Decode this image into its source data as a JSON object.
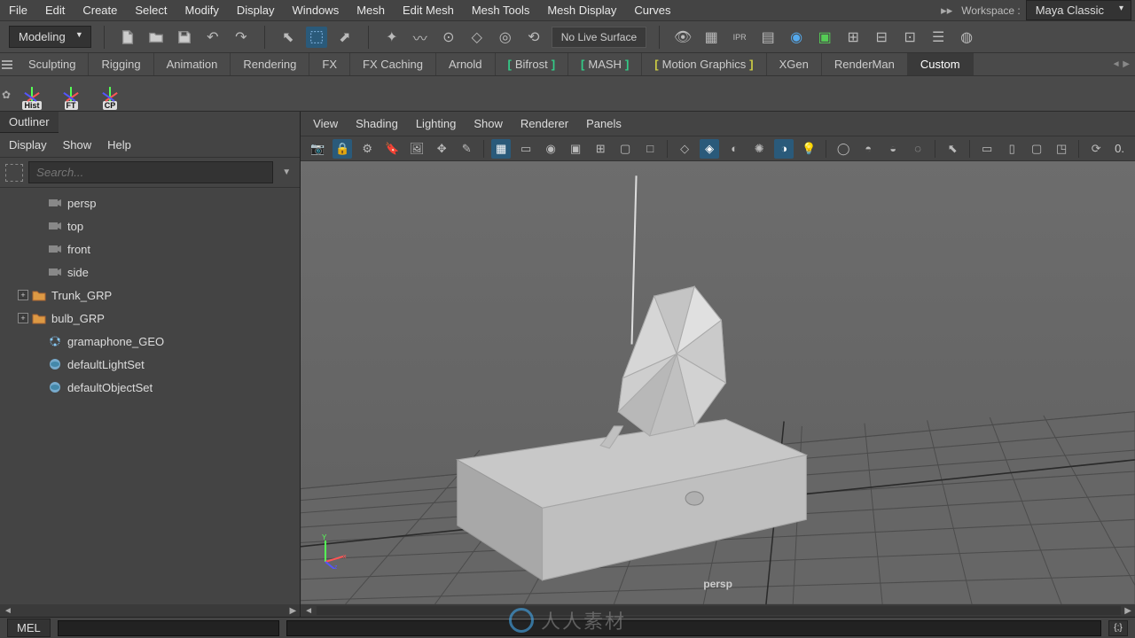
{
  "menubar": [
    "File",
    "Edit",
    "Create",
    "Select",
    "Modify",
    "Display",
    "Windows",
    "Mesh",
    "Edit Mesh",
    "Mesh Tools",
    "Mesh Display",
    "Curves"
  ],
  "workspace_label": "Workspace :",
  "workspace_value": "Maya Classic",
  "module_dropdown": "Modeling",
  "no_live_surface": "No Live Surface",
  "shelf_tabs": [
    {
      "label": "Sculpting",
      "cls": ""
    },
    {
      "label": "Rigging",
      "cls": ""
    },
    {
      "label": "Animation",
      "cls": ""
    },
    {
      "label": "Rendering",
      "cls": ""
    },
    {
      "label": "FX",
      "cls": ""
    },
    {
      "label": "FX Caching",
      "cls": ""
    },
    {
      "label": "Arnold",
      "cls": ""
    },
    {
      "label": "Bifrost",
      "cls": "bracket-l bracket-r"
    },
    {
      "label": "MASH",
      "cls": "bracket-l bracket-r"
    },
    {
      "label": "Motion Graphics",
      "cls": "bracket-y"
    },
    {
      "label": "XGen",
      "cls": ""
    },
    {
      "label": "RenderMan",
      "cls": ""
    },
    {
      "label": "Custom",
      "cls": "active"
    }
  ],
  "shelf_buttons": [
    {
      "label": "Hist",
      "color": "#e6c"
    },
    {
      "label": "FT",
      "color": "#5c5"
    },
    {
      "label": "CP",
      "color": "#c55"
    }
  ],
  "outliner": {
    "title": "Outliner",
    "menus": [
      "Display",
      "Show",
      "Help"
    ],
    "search_placeholder": "Search...",
    "items": [
      {
        "indent": 1,
        "exp": "none",
        "icon": "cam",
        "label": "persp"
      },
      {
        "indent": 1,
        "exp": "none",
        "icon": "cam",
        "label": "top"
      },
      {
        "indent": 1,
        "exp": "none",
        "icon": "cam",
        "label": "front"
      },
      {
        "indent": 1,
        "exp": "none",
        "icon": "cam",
        "label": "side"
      },
      {
        "indent": 0,
        "exp": "plus",
        "icon": "grp",
        "label": "Trunk_GRP"
      },
      {
        "indent": 0,
        "exp": "plus",
        "icon": "grp",
        "label": "bulb_GRP"
      },
      {
        "indent": 1,
        "exp": "none",
        "icon": "mesh",
        "label": "gramaphone_GEO"
      },
      {
        "indent": 1,
        "exp": "none",
        "icon": "set",
        "label": "defaultLightSet"
      },
      {
        "indent": 1,
        "exp": "none",
        "icon": "set",
        "label": "defaultObjectSet"
      }
    ]
  },
  "viewport": {
    "menus": [
      "View",
      "Shading",
      "Lighting",
      "Show",
      "Renderer",
      "Panels"
    ],
    "label": "persp"
  },
  "cmdline": {
    "lang": "MEL"
  },
  "watermark_text": "人人素材",
  "axes": {
    "y": "Y",
    "x": "x",
    "z": "z"
  }
}
